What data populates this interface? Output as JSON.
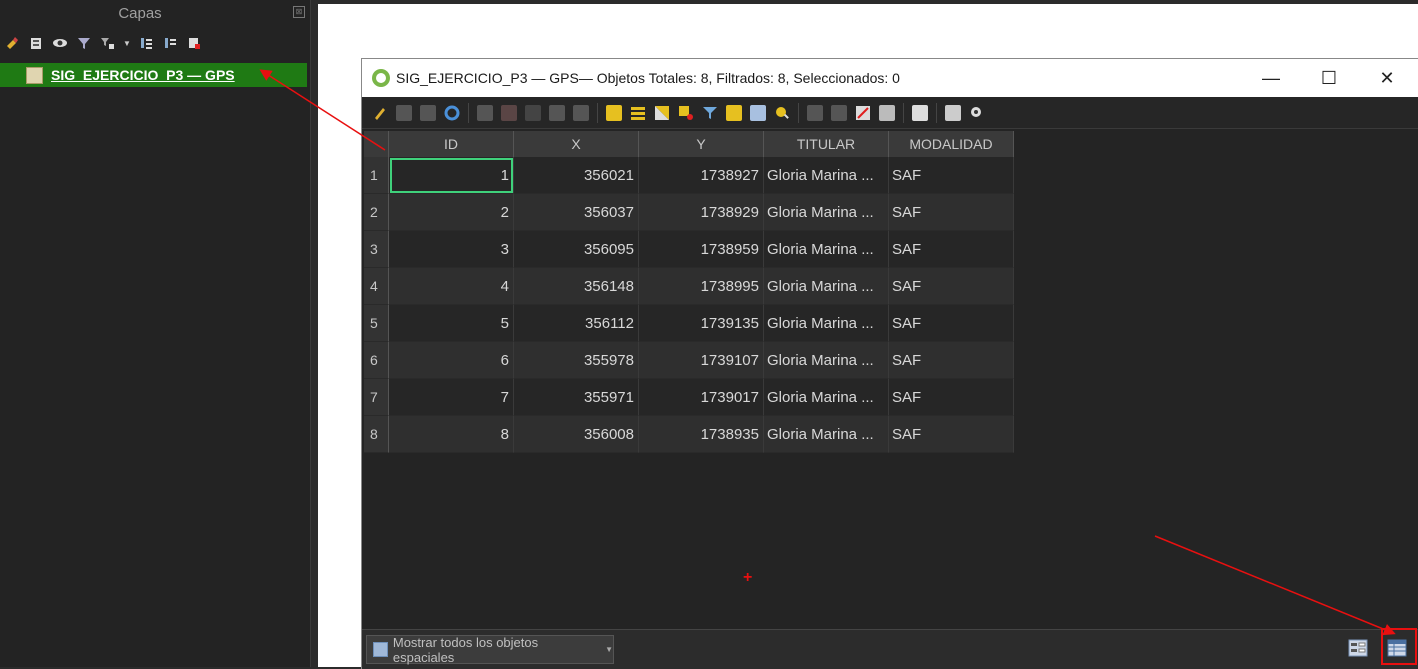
{
  "layers_panel": {
    "title": "Capas",
    "close_glyph": "⊠",
    "toolbar_icons": [
      "open-layer-styling-icon",
      "add-group-icon",
      "manage-visibility-icon",
      "filter-legend-icon",
      "filter-by-expression-icon",
      "expand-all-icon",
      "collapse-all-icon",
      "remove-layer-icon"
    ],
    "layer": {
      "name": "SIG_EJERCICIO_P3 — GPS",
      "icon": "table-layer-icon"
    }
  },
  "attribute_window": {
    "title": "SIG_EJERCICIO_P3 — GPS— Objetos Totales: 8, Filtrados: 8, Seleccionados: 0",
    "controls": {
      "minimize": "—",
      "maximize": "☐",
      "close": "✕"
    },
    "table": {
      "columns": [
        "ID",
        "X",
        "Y",
        "TITULAR",
        "MODALIDAD"
      ],
      "rows": [
        {
          "n": "1",
          "id": "1",
          "x": "356021",
          "y": "1738927",
          "titular": "Gloria Marina ...",
          "modalidad": "SAF"
        },
        {
          "n": "2",
          "id": "2",
          "x": "356037",
          "y": "1738929",
          "titular": "Gloria Marina ...",
          "modalidad": "SAF"
        },
        {
          "n": "3",
          "id": "3",
          "x": "356095",
          "y": "1738959",
          "titular": "Gloria Marina ...",
          "modalidad": "SAF"
        },
        {
          "n": "4",
          "id": "4",
          "x": "356148",
          "y": "1738995",
          "titular": "Gloria Marina ...",
          "modalidad": "SAF"
        },
        {
          "n": "5",
          "id": "5",
          "x": "356112",
          "y": "1739135",
          "titular": "Gloria Marina ...",
          "modalidad": "SAF"
        },
        {
          "n": "6",
          "id": "6",
          "x": "355978",
          "y": "1739107",
          "titular": "Gloria Marina ...",
          "modalidad": "SAF"
        },
        {
          "n": "7",
          "id": "7",
          "x": "355971",
          "y": "1739017",
          "titular": "Gloria Marina ...",
          "modalidad": "SAF"
        },
        {
          "n": "8",
          "id": "8",
          "x": "356008",
          "y": "1738935",
          "titular": "Gloria Marina ...",
          "modalidad": "SAF"
        }
      ]
    },
    "footer": {
      "filter_button": "Mostrar todos los objetos espaciales"
    }
  },
  "colors": {
    "layer_highlight": "#1f7a14",
    "selection_outline": "#3fd17b",
    "annotation_red": "#e81010"
  }
}
